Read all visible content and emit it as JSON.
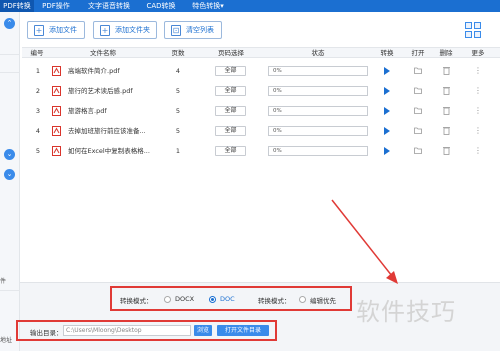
{
  "topbar": {
    "tabs": [
      {
        "label": "PDF转换"
      },
      {
        "label": "PDF操作"
      },
      {
        "label": "文字语音转换"
      },
      {
        "label": "CAD转换"
      },
      {
        "label": "特色转换▾"
      }
    ]
  },
  "left_panel": {
    "frag_1": "件",
    "frag_2": "地址"
  },
  "toolbar": {
    "add_file": "添加文件",
    "add_folder": "添加文件夹",
    "clear_list": "清空列表"
  },
  "table": {
    "headers": {
      "num": "编号",
      "name": "文件名称",
      "pages": "页数",
      "page_select": "页码选择",
      "status": "状态",
      "convert": "转换",
      "open": "打开",
      "delete": "删除",
      "more": "更多"
    },
    "rows": [
      {
        "num": "1",
        "name": "高端软件简介.pdf",
        "pages": "4",
        "page_select": "全部",
        "progress": "0%"
      },
      {
        "num": "2",
        "name": "旅行的艺术读后感.pdf",
        "pages": "5",
        "page_select": "全部",
        "progress": "0%"
      },
      {
        "num": "3",
        "name": "旅游格言.pdf",
        "pages": "5",
        "page_select": "全部",
        "progress": "0%"
      },
      {
        "num": "4",
        "name": "去掉加班旅行前应该准备...",
        "pages": "5",
        "page_select": "全部",
        "progress": "0%"
      },
      {
        "num": "5",
        "name": "如何在Excel中复制表格格...",
        "pages": "1",
        "page_select": "全部",
        "progress": "0%"
      }
    ]
  },
  "options": {
    "convert_mode_label": "转换模式：",
    "docx": "DOCX",
    "doc": "DOC",
    "selected": "DOC",
    "convert_mode2_label": "转换模式：",
    "edit_priority": "编辑优先"
  },
  "output": {
    "label": "输出目录：",
    "path": "C:\\Users\\Mloong\\Desktop",
    "browse": "浏览",
    "open_dir": "打开文件目录"
  },
  "watermark": "软件技巧",
  "colors": {
    "brand": "#1b6fd1",
    "highlight": "#e03a36"
  }
}
